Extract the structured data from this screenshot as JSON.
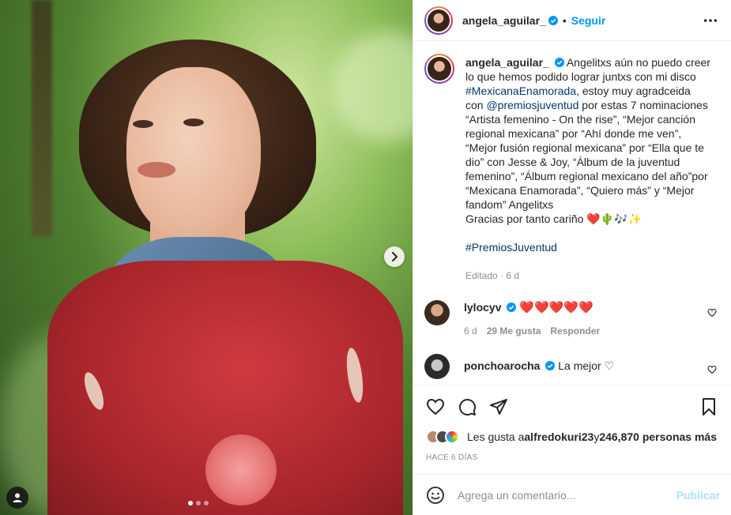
{
  "post": {
    "username": "angela_aguilar_",
    "follow_label": "Seguir",
    "separator": "•"
  },
  "caption": {
    "username": "angela_aguilar_",
    "text_1": " Angelitxs aún no puedo creer lo que hemos podido lograr juntxs con mi disco ",
    "hashtag_1": "#MexicanaEnamorada",
    "text_2": ", estoy muy agradceida con ",
    "mention": "@premiosjuventud",
    "text_3": " por estas 7 nominaciones “Artista femenino - On the rise”, “Mejor canción regional mexicana” por “Ahí donde me ven”, “Mejor fusión regional mexicana” por “Ella que te dio” con Jesse & Joy, “Álbum de la juventud femenino”, “Álbum regional mexicano del año”por “Mexicana Enamorada”, “Quiero más” y “Mejor fandom” Angelitxs",
    "text_4": "Gracias por tanto cariño ",
    "emojis": "❤️🌵🎶✨",
    "hashtag_2": "#PremiosJuventud",
    "meta": "Editado · 6 d"
  },
  "comments": [
    {
      "username": "lylocyv",
      "text": "❤️❤️❤️❤️❤️",
      "age": "6 d",
      "likes": "29 Me gusta",
      "reply": "Responder"
    },
    {
      "username": "ponchoarocha",
      "text": "La mejor ♡"
    }
  ],
  "likes": {
    "prefix": "Les gusta a ",
    "user": "alfredokuri23",
    "middle": " y ",
    "others": "246,870 personas más"
  },
  "timestamp": "HACE 6 DÍAS",
  "add_comment": {
    "placeholder": "Agrega un comentario...",
    "publish_label": "Publicar"
  },
  "colors": {
    "accent": "#0095f6",
    "link": "#00376b",
    "muted": "#8e8e8e",
    "heart": "#e0245e"
  }
}
